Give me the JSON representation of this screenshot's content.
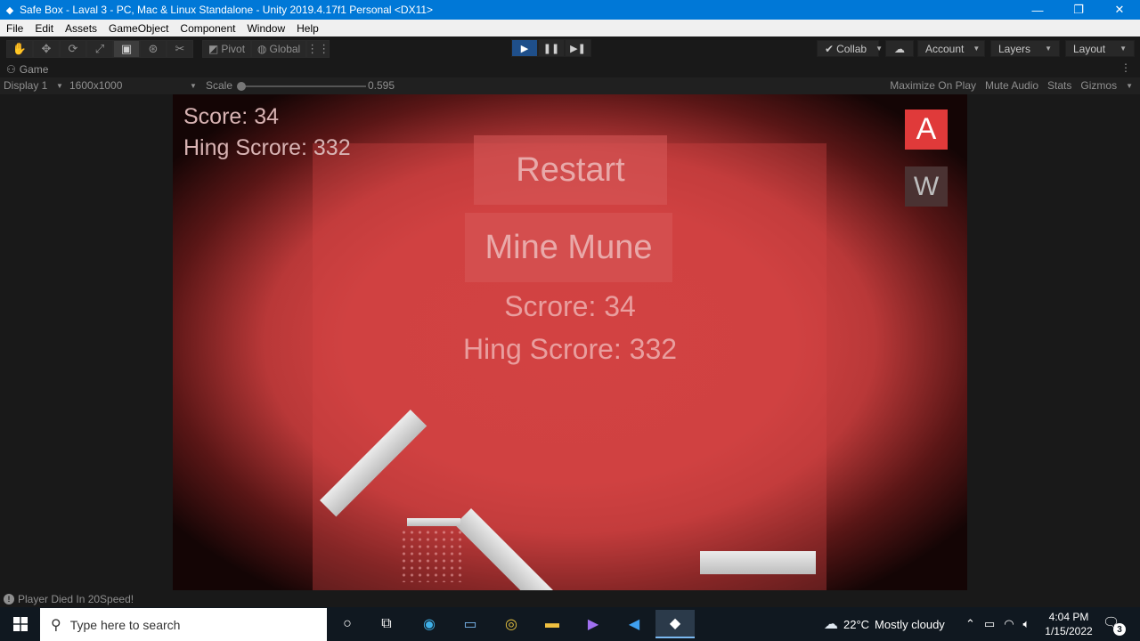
{
  "window": {
    "title": "Safe Box - Laval 3 - PC, Mac & Linux Standalone - Unity 2019.4.17f1 Personal <DX11>",
    "minimize": "—",
    "restore": "❐",
    "close": "✕"
  },
  "menu": [
    "File",
    "Edit",
    "Assets",
    "GameObject",
    "Component",
    "Window",
    "Help"
  ],
  "toolbar": {
    "pivot_label": "Pivot",
    "global_label": "Global",
    "collab_label": "Collab",
    "account_label": "Account",
    "layers_label": "Layers",
    "layout_label": "Layout"
  },
  "game_tab": {
    "label": "Game",
    "display": "Display 1",
    "resolution": "1600x1000",
    "scale_label": "Scale",
    "scale_value": "0.595",
    "scale_fraction": 0.0,
    "maximize": "Maximize On Play",
    "mute": "Mute Audio",
    "stats": "Stats",
    "gizmos": "Gizmos"
  },
  "game": {
    "hud_score": "Score: 34",
    "hud_high_score": "Hing Scrore: 332",
    "restart_label": "Restart",
    "main_menu_label": "Mine Mune",
    "panel_score": "Scrore: 34",
    "panel_high_score": "Hing Scrore: 332",
    "key_a": "A",
    "key_w": "W",
    "colors": {
      "accent_red": "#e03a3a",
      "background_red": "#cd4040"
    }
  },
  "status": {
    "message": "Player Died In 20Speed!"
  },
  "taskbar": {
    "search_placeholder": "Type here to search",
    "weather_temp": "22°C",
    "weather_desc": "Mostly cloudy",
    "time": "4:04 PM",
    "date": "1/15/2022",
    "notification_count": "3"
  }
}
